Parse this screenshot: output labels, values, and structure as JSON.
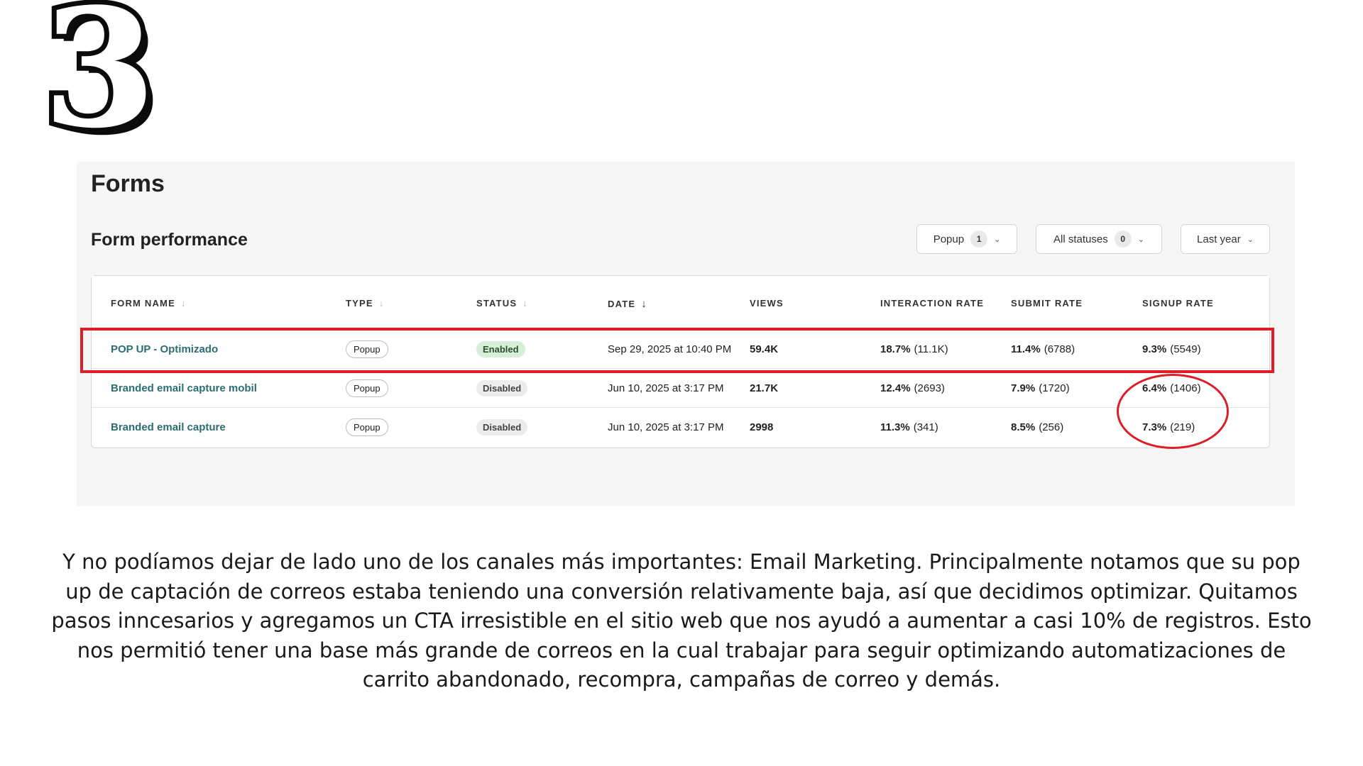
{
  "step_number": "3",
  "page_title": "Forms",
  "section_title": "Form performance",
  "filters": [
    {
      "label": "Popup",
      "count": "1"
    },
    {
      "label": "All statuses",
      "count": "0"
    },
    {
      "label": "Last year",
      "count": null
    }
  ],
  "table": {
    "headers": [
      "FORM NAME",
      "TYPE",
      "STATUS",
      "DATE",
      "VIEWS",
      "INTERACTION RATE",
      "SUBMIT RATE",
      "SIGNUP RATE"
    ],
    "rows": [
      {
        "name": "POP UP - Optimizado",
        "type": "Popup",
        "status": "Enabled",
        "date": "Sep 29, 2025 at 10:40 PM",
        "views": "59.4K",
        "interaction_pct": "18.7%",
        "interaction_count": "(11.1K)",
        "submit_pct": "11.4%",
        "submit_count": "(6788)",
        "signup_pct": "9.3%",
        "signup_count": "(5549)"
      },
      {
        "name": "Branded email capture mobil",
        "type": "Popup",
        "status": "Disabled",
        "date": "Jun 10, 2025 at 3:17 PM",
        "views": "21.7K",
        "interaction_pct": "12.4%",
        "interaction_count": "(2693)",
        "submit_pct": "7.9%",
        "submit_count": "(1720)",
        "signup_pct": "6.4%",
        "signup_count": "(1406)"
      },
      {
        "name": "Branded email capture",
        "type": "Popup",
        "status": "Disabled",
        "date": "Jun 10, 2025 at 3:17 PM",
        "views": "2998",
        "interaction_pct": "11.3%",
        "interaction_count": "(341)",
        "submit_pct": "8.5%",
        "submit_count": "(256)",
        "signup_pct": "7.3%",
        "signup_count": "(219)"
      }
    ]
  },
  "caption": "Y no podíamos dejar de lado uno de los canales más importantes: Email Marketing. Principalmente notamos que su pop up de captación de correos estaba teniendo una conversión relativamente baja, así que decidimos optimizar. Quitamos pasos inncesarios y agregamos un CTA irresistible en el sitio web que nos ayudó a aumentar a casi 10% de registros. Esto nos permitió tener una base más grande de correos en la cual trabajar para seguir optimizando automatizaciones de carrito abandonado, recompra, campañas de correo y demás.",
  "colors": {
    "highlight": "#dc1f26",
    "link": "#2b6e72",
    "enabled_badge": "#d6efd9",
    "panel": "#f6f6f6"
  },
  "icons": {
    "sort": "arrow-down-icon",
    "dropdown": "chevron-down-icon"
  }
}
